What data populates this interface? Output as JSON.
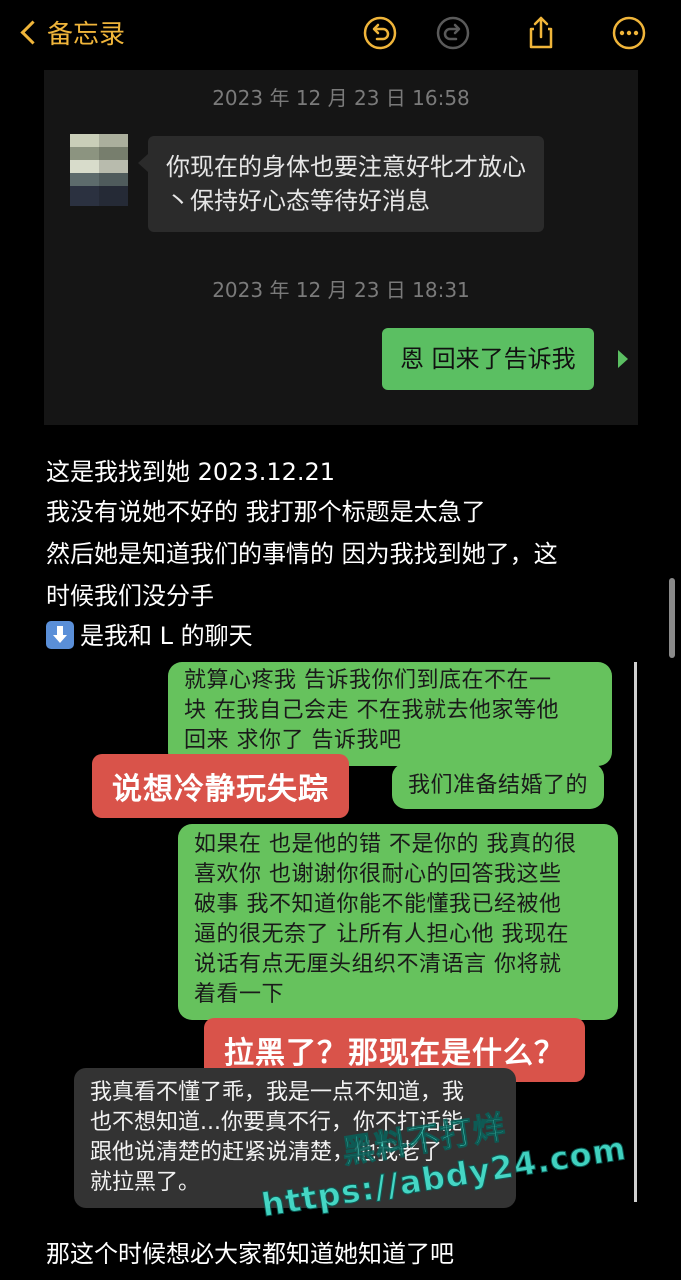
{
  "nav": {
    "back_label": "备忘录"
  },
  "chat1": {
    "timestamp1": "2023 年 12 月 23 日 16:58",
    "msg_in_line1": "你现在的身体也要注意好牝才放心",
    "msg_in_line2": "丶保持好心态等待好消息",
    "timestamp2": "2023 年 12 月 23 日 18:31",
    "msg_out": "恩 回来了告诉我"
  },
  "note": {
    "line1": "这是我找到她 2023.12.21",
    "line2": "我没有说她不好的 我打那个标题是太急了",
    "line3": "然后她是知道我们的事情的 因为我找到她了，这",
    "line4": "时候我们没分手",
    "line5": "是我和 L 的聊天",
    "line_last": "那这个时候想必大家都知道她知道了吧"
  },
  "chat2": {
    "green1": [
      "就算心疼我 告诉我你们到底在不在一",
      "块 在我自己会走 不在我就去他家等他",
      "回来 求你了 告诉我吧"
    ],
    "label1": "说想冷静玩失踪",
    "green2": "我们准备结婚了的",
    "green3": [
      "如果在 也是他的错 不是你的 我真的很",
      "喜欢你 也谢谢你很耐心的回答我这些",
      "破事 我不知道你能不能懂我已经被他",
      "逼的很无奈了 让所有人担心他 我现在",
      "说话有点无厘头组织不清语言 你将就",
      "着看一下"
    ],
    "label2": "拉黑了？那现在是什么？",
    "gray1": [
      "我真看不懂了乖，我是一点不知道，我",
      "也不想知道...你要真不行，你不打话能",
      "跟他说清楚的赶紧说清楚，他我老了",
      "就拉黑了。"
    ]
  },
  "watermark": {
    "line1": "黑料不打烊",
    "line2": "https://abdy24.com"
  },
  "colors": {
    "accent": "#f0b53a",
    "green_bubble": "#66c25d",
    "red_label": "#d9534a"
  }
}
